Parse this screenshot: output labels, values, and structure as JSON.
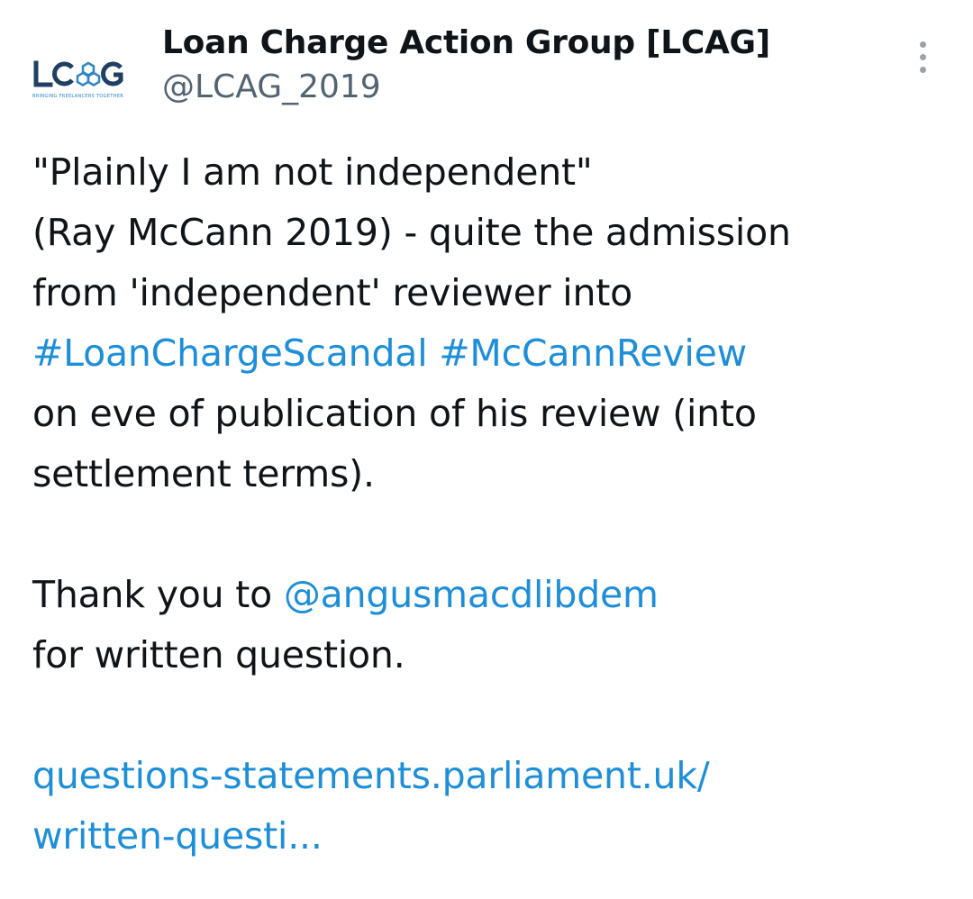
{
  "author": {
    "display_name": "Loan Charge Action Group [LCAG]",
    "handle": "@LCAG_2019",
    "avatar": {
      "logo_text": "LC G",
      "tagline": "BRINGING FREELANCERS TOGETHER",
      "icon": "hexagon-network-icon"
    }
  },
  "more_button": {
    "icon": "vertical-ellipsis-icon"
  },
  "tweet": {
    "lines": [
      [
        {
          "text": "\"Plainly I am not independent\"",
          "link": false
        }
      ],
      [
        {
          "text": "(Ray McCann 2019) - quite the admission",
          "link": false
        }
      ],
      [
        {
          "text": "from 'independent' reviewer into",
          "link": false
        }
      ],
      [
        {
          "text": "#LoanChargeScandal",
          "link": true
        },
        {
          "text": " ",
          "link": false
        },
        {
          "text": "#McCannReview",
          "link": true
        }
      ],
      [
        {
          "text": "on eve of publication of his review (into",
          "link": false
        }
      ],
      [
        {
          "text": "settlement terms).",
          "link": false
        }
      ],
      [],
      [
        {
          "text": "Thank you to ",
          "link": false
        },
        {
          "text": "@angusmacdlibdem",
          "link": true
        }
      ],
      [
        {
          "text": "for written question.",
          "link": false
        }
      ],
      [],
      [
        {
          "text": "questions-statements.parliament.uk/",
          "link": true
        }
      ],
      [
        {
          "text": "written-questi...",
          "link": true
        }
      ]
    ]
  },
  "colors": {
    "text": "#0f1419",
    "secondary": "#536471",
    "link": "#1d8ed8",
    "logo_dark": "#1f3f63",
    "logo_accent": "#2f86c6"
  }
}
